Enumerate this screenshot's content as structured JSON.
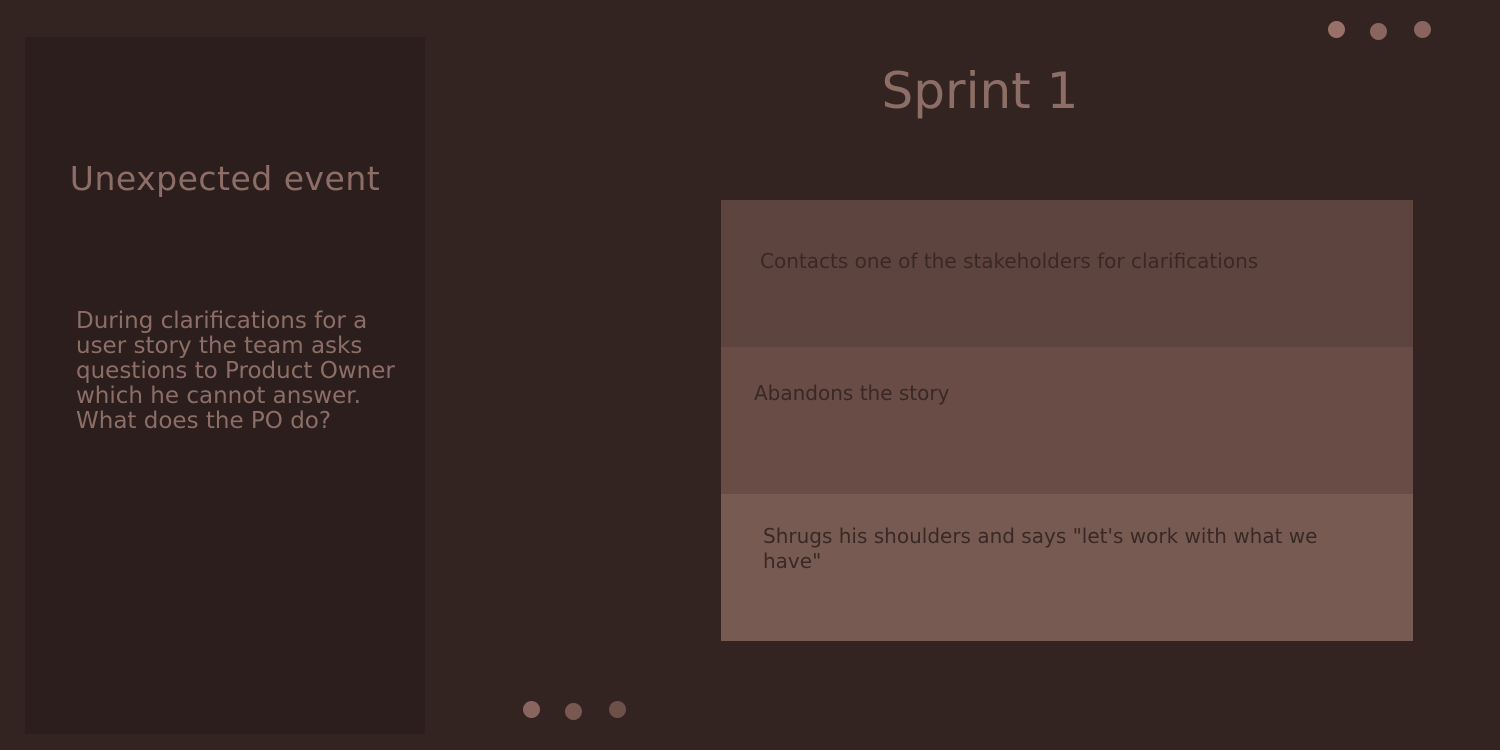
{
  "event_panel": {
    "title": "Unexpected event",
    "description": "During clarifications for a user story the team asks questions to Product Owner which he cannot answer. What does the PO do?"
  },
  "sprint": {
    "title": "Sprint 1"
  },
  "options": [
    {
      "label": "Contacts one of the stakeholders for clarifications"
    },
    {
      "label": "Abandons the story"
    },
    {
      "label": "Shrugs his shoulders and says \"let's work with what we have\""
    }
  ],
  "colors": {
    "background": "#332422",
    "panel": "#2b1e1c",
    "text_muted": "#8d6e66",
    "option_1": "#5e443e",
    "option_2": "#684c45",
    "option_3": "#775b52",
    "option_text": "#3a2826",
    "dot_light": "#9a7169",
    "dot_mid": "#8a6560",
    "dot_dark": "#7a5852"
  }
}
